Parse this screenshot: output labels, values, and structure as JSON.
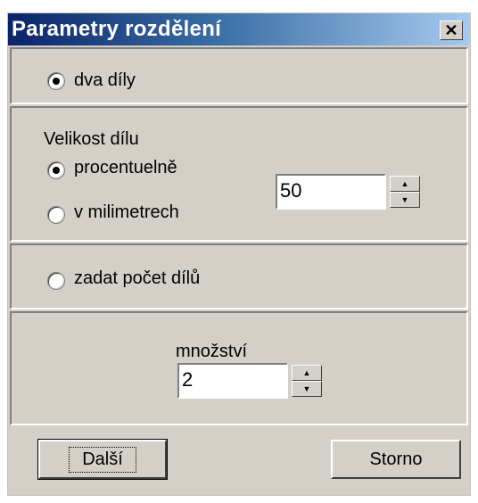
{
  "dialog": {
    "title": "Parametry rozdělení",
    "close_icon": "close-icon"
  },
  "option_parts": {
    "label": "dva díly",
    "selected": true
  },
  "size_group": {
    "title": "Velikost dílu",
    "percent_label": "procentuelně",
    "percent_selected": true,
    "mm_label": "v milimetrech",
    "mm_selected": false,
    "value": "50"
  },
  "option_count": {
    "label": "zadat počet dílů",
    "selected": false
  },
  "count_group": {
    "label": "množství",
    "value": "2"
  },
  "buttons": {
    "next": "Další",
    "cancel": "Storno"
  }
}
